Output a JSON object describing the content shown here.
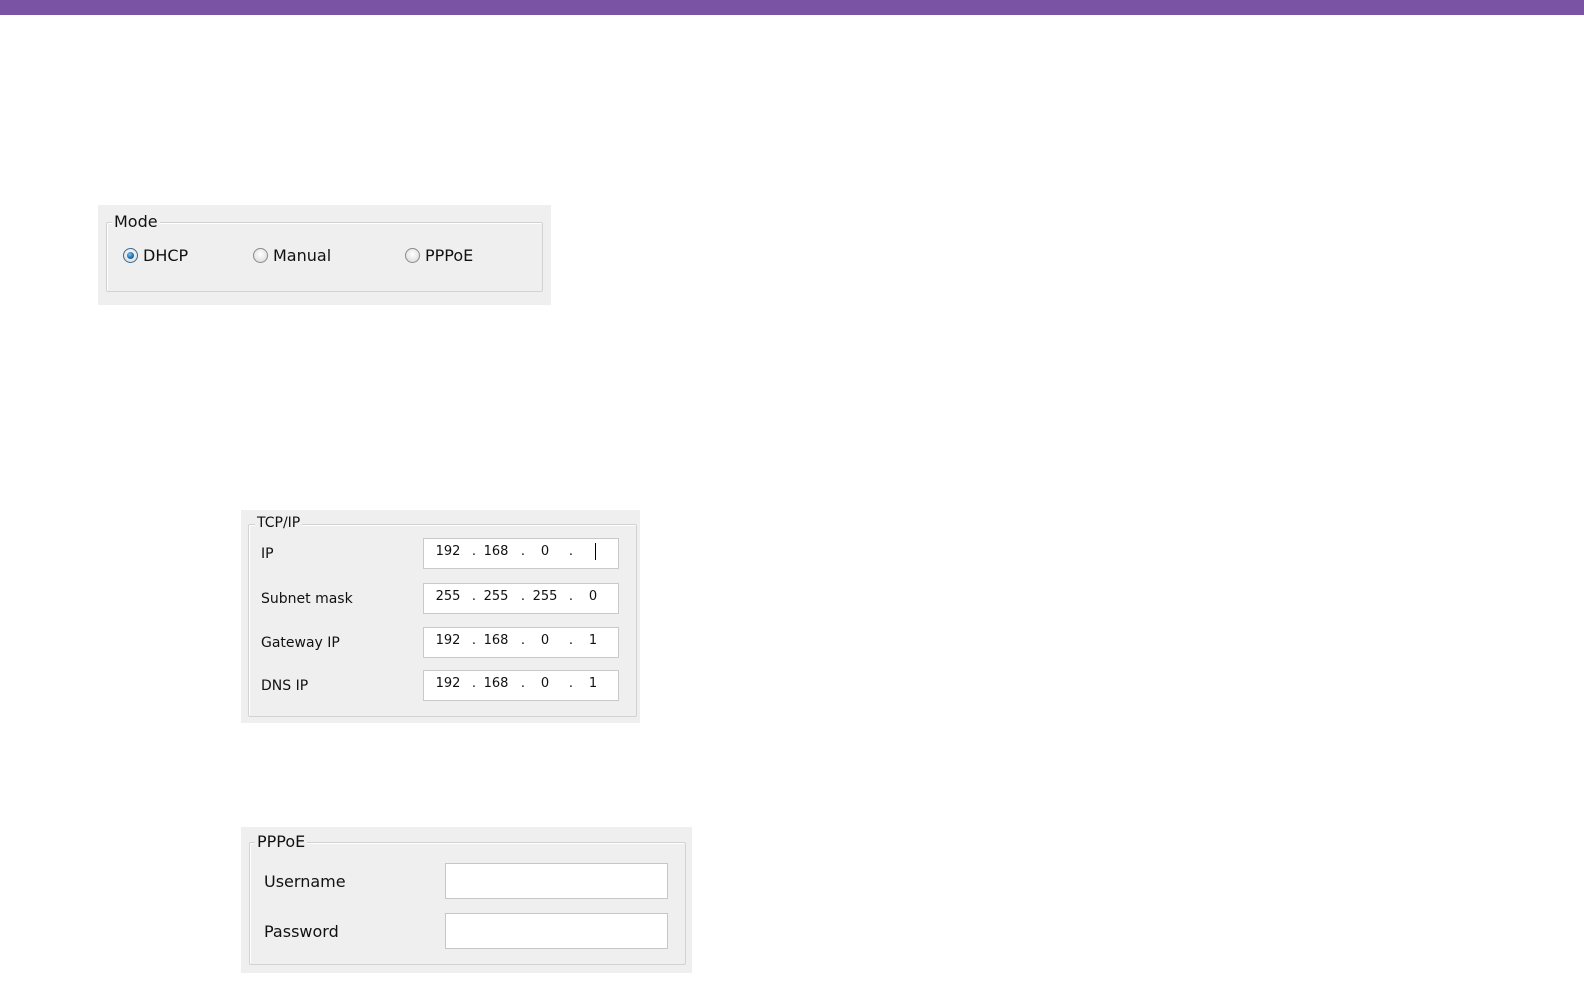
{
  "theme": {
    "accent_bar_color": "#7b53a4"
  },
  "mode": {
    "title": "Mode",
    "options": [
      {
        "label": "DHCP",
        "checked": true
      },
      {
        "label": "Manual",
        "checked": false
      },
      {
        "label": "PPPoE",
        "checked": false
      }
    ]
  },
  "tcpip": {
    "title": "TCP/IP",
    "fields": [
      {
        "label": "IP",
        "octets": [
          "192",
          "168",
          "0",
          ""
        ]
      },
      {
        "label": "Subnet mask",
        "octets": [
          "255",
          "255",
          "255",
          "0"
        ]
      },
      {
        "label": "Gateway IP",
        "octets": [
          "192",
          "168",
          "0",
          "1"
        ]
      },
      {
        "label": "DNS IP",
        "octets": [
          "192",
          "168",
          "0",
          "1"
        ]
      }
    ],
    "separator": "."
  },
  "pppoe": {
    "title": "PPPoE",
    "username_label": "Username",
    "username_value": "",
    "password_label": "Password",
    "password_value": ""
  }
}
